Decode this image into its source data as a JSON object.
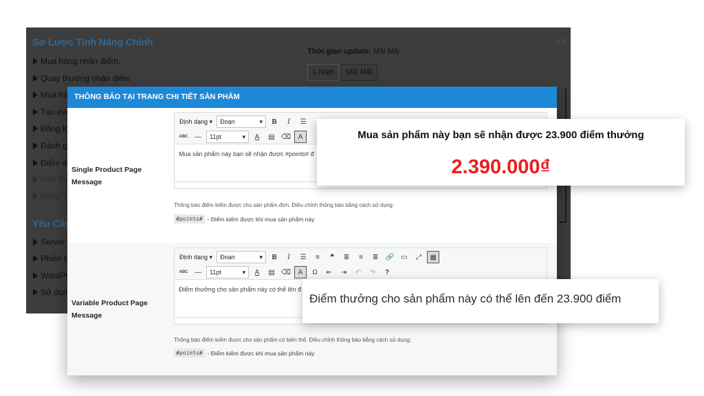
{
  "background": {
    "title": "Sơ Lược Tính Năng Chính",
    "items": [
      "Mua hàng nhận điểm.",
      "Quay thưởng nhận điểm.",
      "Mua hàng",
      "Tạo eve",
      "Đăng ký",
      "Đánh giá",
      "Điểm da",
      "Giới thiệ",
      "Đăng ?"
    ],
    "section2_title": "Yêu Cầu",
    "section2_items": [
      "Server c",
      "Phiên bả",
      "WordPre",
      "Sử dụng"
    ],
    "close_label": "XÓA",
    "update_label": "Thời gian update:",
    "update_value": "Mãi Mãi",
    "plan_buttons": [
      "1 Năm",
      "Mãi Mãi"
    ]
  },
  "modal": {
    "title": "THÔNG BÁO TẠI TRANG CHI TIẾT SẢN PHẨM",
    "toolbar": {
      "format_label": "Định dạng",
      "paragraph": "Đoạn",
      "font_size": "11pt"
    },
    "single": {
      "label": "Single Product Page Message",
      "content": "Mua sản phẩm này bạn sẽ nhận được #points# đ",
      "help": "Thông báo điểm kiếm được cho sản phẩm đơn. Điều chỉnh thông báo bằng cách sử dụng:",
      "tag": "#points#",
      "tag_desc": "- Điểm kiếm được khi mua sản phẩm này"
    },
    "variable": {
      "label": "Variable Product Page Message",
      "content": "Điểm thưởng cho sản phẩm này có thể lên đ",
      "help": "Thông báo điểm kiếm được cho sản phẩm có biến thể. Điều chỉnh thông báo bằng cách sử dụng:",
      "tag": "#points#",
      "tag_desc": "- Điểm kiếm được khi mua sản phẩm này"
    }
  },
  "callouts": {
    "single_message": "Mua sản phẩm này bạn sẽ nhận được 23.900 điểm thưởng",
    "single_price": "2.390.000₫",
    "variable_message": "Điểm thưởng cho sản phẩm này có thể lên đến 23.900 điểm"
  },
  "colors": {
    "header_blue": "#1e88d8",
    "price_red": "#ee1c1c"
  }
}
